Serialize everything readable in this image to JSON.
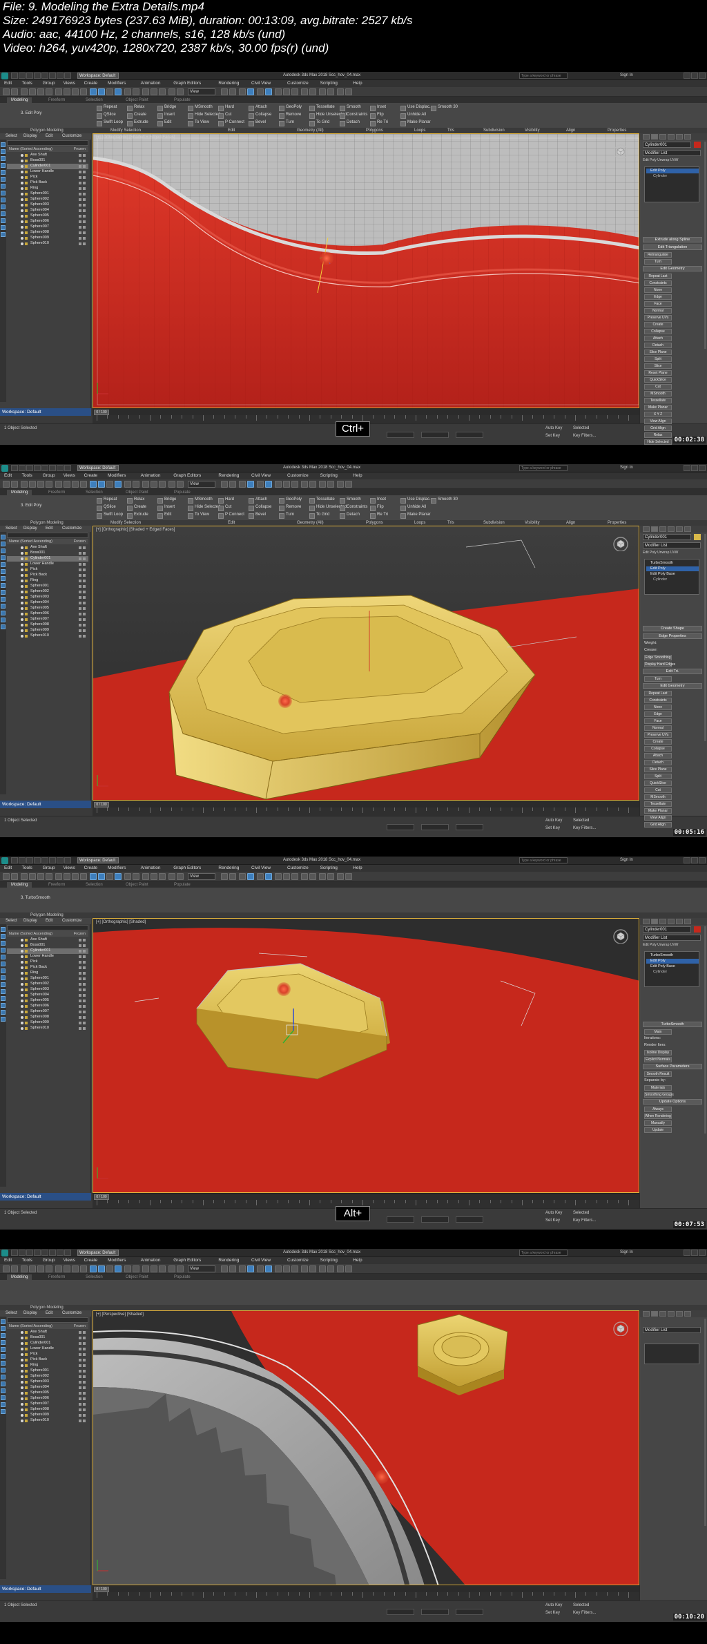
{
  "info": {
    "file": "File: 9. Modeling the Extra Details.mp4",
    "size": "Size: 249176923 bytes (237.63 MiB), duration: 00:13:09, avg.bitrate: 2527 kb/s",
    "audio": "Audio: aac, 44100 Hz, 2 channels, s16, 128 kb/s (und)",
    "video": "Video: h264, yuv420p, 1280x720, 2387 kb/s, 30.00 fps(r) (und)"
  },
  "app": {
    "workspace": "Workspace: Default",
    "window_title": "Autodesk 3ds Max 2018    Scc_hov_04.max",
    "search_placeholder": "Type a keyword or phrase",
    "signin": "Sign In",
    "menus": [
      "Edit",
      "Tools",
      "Group",
      "Views",
      "Create",
      "Modifiers",
      "Animation",
      "Graph Editors",
      "Rendering",
      "Civil View",
      "Customize",
      "Scripting",
      "Help"
    ],
    "view_dropdown": "View",
    "ribbon_tabs": [
      "Modeling",
      "Freeform",
      "Selection",
      "Object Paint",
      "Populate"
    ],
    "ribbon_groups": [
      "Polygon Modeling",
      "Modify Selection",
      "Edit",
      "Geometry (All)",
      "Polygons",
      "Loops",
      "Tris",
      "Subdivision",
      "Visibility",
      "Align",
      "Properties"
    ],
    "ribbon_tools": [
      "Repeat",
      "QSlice",
      "Swift Loop",
      "Relax",
      "Create",
      "Extrude",
      "Bridge",
      "Insert",
      "Edit",
      "MSmooth",
      "Hide Selected",
      "To View",
      "Hard",
      "Cut",
      "P Connect",
      "Attach",
      "Collapse",
      "Bevel",
      "GeoPoly",
      "Remove",
      "Turn",
      "Tessellate",
      "Hide Unselected",
      "To Grid",
      "Smooth",
      "Constraints",
      "Detach",
      "Inset",
      "Flip",
      "Re Tri",
      "Use Displac.",
      "Unhide All",
      "Make Planar",
      "Smooth 30"
    ],
    "scene_tabs": [
      "Select",
      "Display",
      "Edit",
      "Customize"
    ],
    "scene_header": "Name (Sorted Ascending)",
    "scene_header_right": "Frozen",
    "scene_items": [
      "Axe Shaft",
      "Boss001",
      "Cylinder001",
      "Lower Handle",
      "Pick",
      "Pick Back",
      "Ring",
      "Sphere001",
      "Sphere002",
      "Sphere003",
      "Sphere004",
      "Sphere005",
      "Sphere006",
      "Sphere007",
      "Sphere008",
      "Sphere009",
      "Sphere010"
    ],
    "footer_workspace": "Workspace: Default",
    "status_text": "1 Object Selected",
    "status_autokey": "Auto Key",
    "status_selected": "Selected",
    "status_setkey": "Set Key",
    "status_filters": "Key Filters...",
    "frame_counter": "0 / 100",
    "object_name": "Cylinder001",
    "modifier_list": "Modifier List",
    "stack_buttons": "Edit Poly    Unwrap UVW",
    "stack_editpoly": "Edit Poly",
    "stack_cylinder": "Cylinder"
  },
  "frames": [
    {
      "timecode": "00:02:38",
      "viewport_label": "[+] [Orthographic] [Shaded + Edged Faces]",
      "key_overlay": "Ctrl+",
      "ribbon_mode": "3. Edit Poly",
      "stack": [
        "Edit Poly",
        "Cylinder"
      ],
      "panel": [
        "Extrude along Spline",
        "Edit Triangulation",
        "Retriangulate",
        "Turn",
        "Edit Geometry",
        "Repeat Last",
        "Constraints",
        "None",
        "Edge",
        "Face",
        "Normal",
        "Preserve UVs",
        "Create",
        "Collapse",
        "Attach",
        "Detach",
        "Slice Plane",
        "Split",
        "Slice",
        "Reset Plane",
        "QuickSlice",
        "Cut",
        "MSmooth",
        "Tessellate",
        "Make Planar",
        "X Y Z",
        "View Align",
        "Grid Align",
        "Relax",
        "Hide Selected",
        "Unhide All",
        "Hide Unselected",
        "Named Selections:"
      ]
    },
    {
      "timecode": "00:05:16",
      "viewport_label": "[+] [Orthographic] [Shaded + Edged Faces]",
      "key_overlay": "",
      "ribbon_mode": "3. Edit Poly",
      "stack": [
        "TurboSmooth",
        "Edit Poly",
        "Edit Poly Base",
        "Cylinder"
      ],
      "panel": [
        "Create Shape",
        "Edge Properties",
        "Weight:",
        "Crease:",
        "Edge Smoothing",
        "Display Hard Edges",
        "Edit Tri.",
        "Turn",
        "Edit Geometry",
        "Repeat Last",
        "Constraints",
        "None",
        "Edge",
        "Face",
        "Normal",
        "Preserve UVs",
        "Create",
        "Collapse",
        "Attach",
        "Detach",
        "Slice Plane",
        "Split",
        "QuickSlice",
        "Cut",
        "MSmooth",
        "Tessellate",
        "Make Planar",
        "View Align",
        "Grid Align"
      ]
    },
    {
      "timecode": "00:07:53",
      "viewport_label": "[+] [Orthographic] [Shaded]",
      "key_overlay": "Alt+",
      "ribbon_mode": "3. TurboSmooth",
      "stack": [
        "TurboSmooth",
        "Edit Poly",
        "Edit Poly Base",
        "Cylinder"
      ],
      "panel": [
        "TurboSmooth",
        "Main",
        "Iterations:",
        "Render Iters:",
        "Isoline Display",
        "Explicit Normals",
        "Surface Parameters",
        "Smooth Result",
        "Separate by:",
        "Materials",
        "Smoothing Groups",
        "Update Options",
        "Always",
        "When Rendering",
        "Manually",
        "Update"
      ]
    },
    {
      "timecode": "00:10:20",
      "viewport_label": "[+] [Perspective] [Shaded]",
      "key_overlay": "",
      "ribbon_mode": "",
      "stack": [],
      "panel": []
    }
  ],
  "colors": {
    "viewport_border": "#e2b33c",
    "selection_red": "#c6281c",
    "object_yellow": "#d9b94a",
    "ui_panel": "#464646",
    "workspace_blue": "#2a4f86"
  }
}
